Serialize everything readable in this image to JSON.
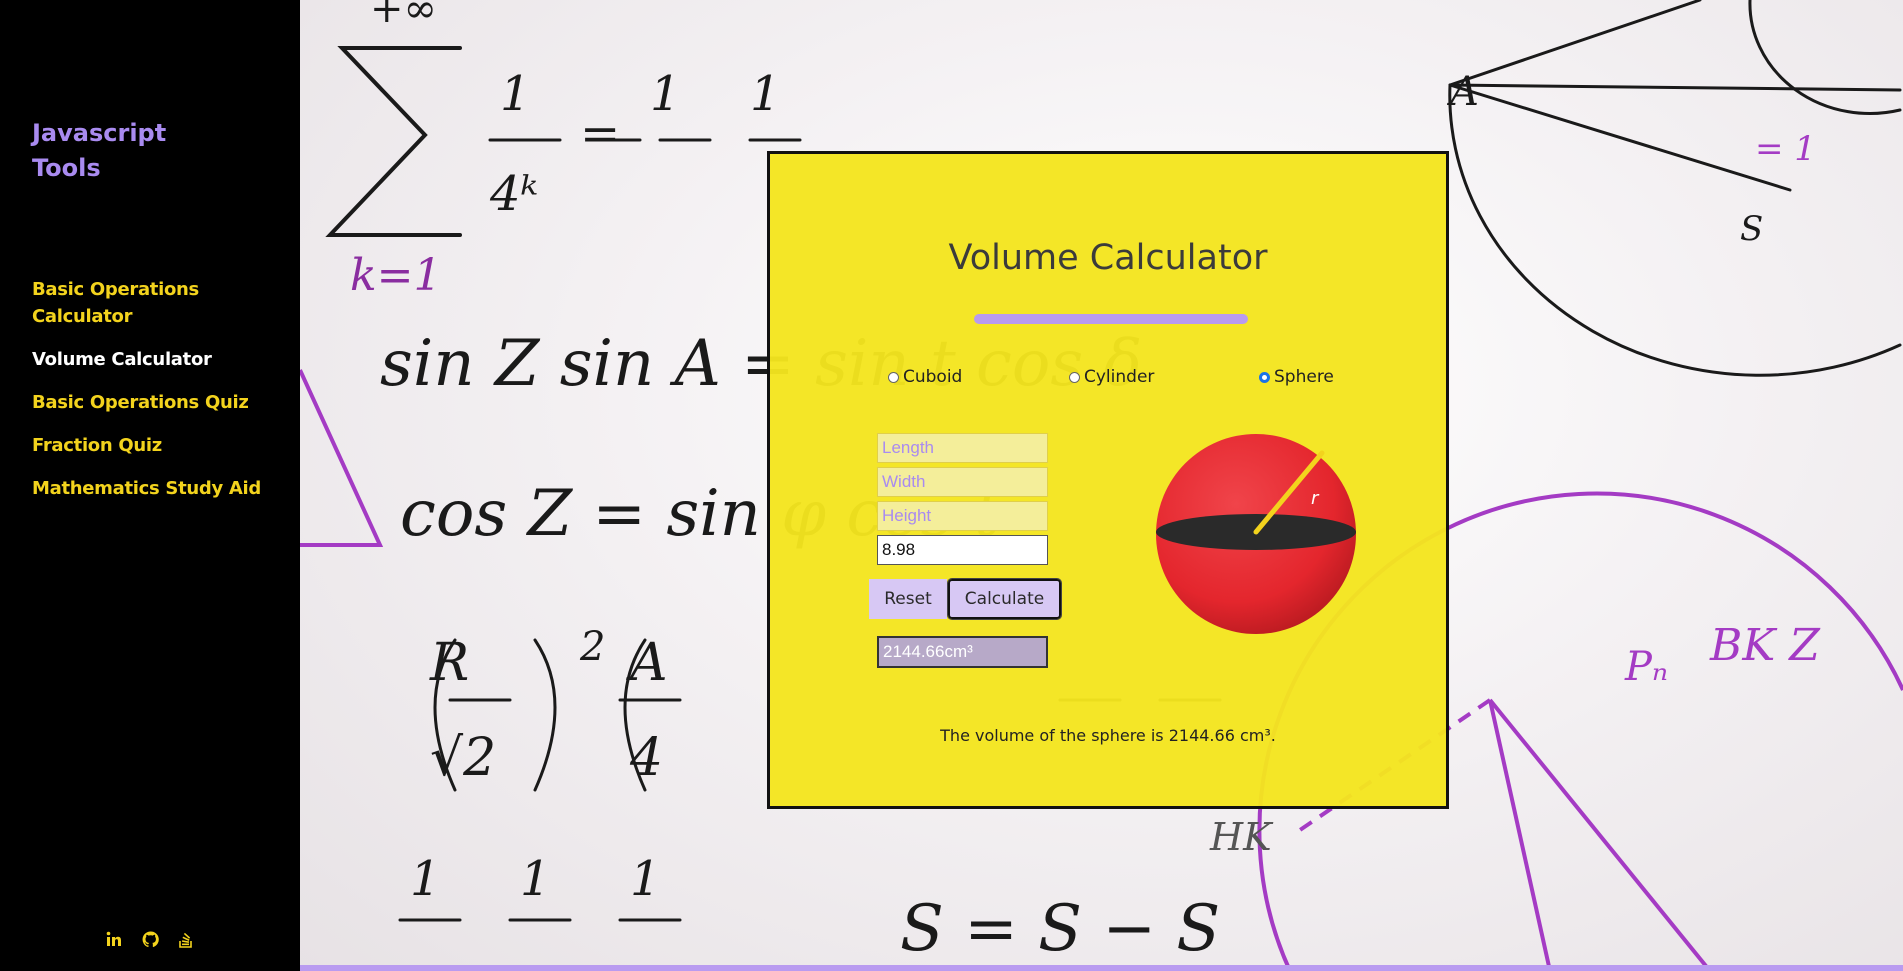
{
  "sidebar": {
    "brand": "Javascript Tools",
    "nav": [
      {
        "label": "Basic Operations Calculator",
        "active": false
      },
      {
        "label": "Volume Calculator",
        "active": true
      },
      {
        "label": "Basic Operations Quiz",
        "active": false
      },
      {
        "label": "Fraction Quiz",
        "active": false
      },
      {
        "label": "Mathematics Study Aid",
        "active": false
      }
    ],
    "social": [
      "linkedin-icon",
      "github-icon",
      "stackoverflow-icon"
    ]
  },
  "calculator": {
    "title": "Volume Calculator",
    "shapes": [
      {
        "label": "Cuboid",
        "checked": false
      },
      {
        "label": "Cylinder",
        "checked": false
      },
      {
        "label": "Sphere",
        "checked": true
      }
    ],
    "fields": {
      "length_placeholder": "Length",
      "width_placeholder": "Width",
      "height_placeholder": "Height",
      "radius_value": "8.98"
    },
    "reset_label": "Reset",
    "calculate_label": "Calculate",
    "result_value": "2144.66cm³",
    "result_sentence": "The volume of the sphere is 2144.66 cm³.",
    "sphere_label": "r"
  },
  "colors": {
    "accent_purple": "#b99bf0",
    "nav_yellow": "#f3d31d",
    "card_yellow": "#f4e51e",
    "sphere_red": "#e4262d"
  }
}
